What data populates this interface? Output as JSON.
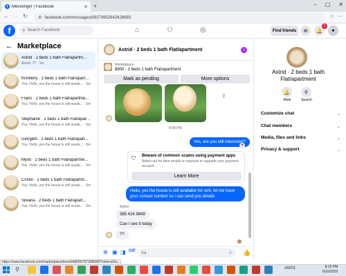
{
  "browser": {
    "tab_title": "Messenger | Facebook",
    "new_tab": "+",
    "url": "facebook.com/messages/t/8274952642628683",
    "window_controls": [
      "–",
      "▢",
      "✕"
    ]
  },
  "fb_header": {
    "search_placeholder": "Search Facebook",
    "find_friends": "Find friends",
    "notif_count": "2"
  },
  "left": {
    "title": "Marketplace",
    "items": [
      {
        "name": "Astrid · 2 beds 1 bath Flat/apartm...",
        "preview": "Astrid: ?? · 1m",
        "selected": true
      },
      {
        "name": "Kimberly · 2 beds 1 bath Flat/apart...",
        "preview": "You: Hello, yes the house is still availa... · 5m"
      },
      {
        "name": "Franc · 2 beds 1 bath Flat/apartme...",
        "preview": "You: Hello, yes the house is still availa... · 5m"
      },
      {
        "name": "Stephanie · 2 beds 1 bath Flat/apar...",
        "preview": "You: Hello, yes the house is still availa... · 5m"
      },
      {
        "name": "Giorgeth · 2 beds 1 bath Flat/apart...",
        "preview": "You: Hello, yes the house is still availa... · 5m"
      },
      {
        "name": "Mysti · 2 beds 1 bath Flat/apartme...",
        "preview": "You: Hello, yes the house is still availa... · 6m"
      },
      {
        "name": "Cristin · 2 beds 1 bath Flat/apartm...",
        "preview": "You: Hello, yes the house is still availa... · 6m"
      },
      {
        "name": "Silvana · 2 beds 1 bath Flat/apart...",
        "preview": "You: Hello, yes the house is still availa... · 6m"
      }
    ]
  },
  "chat": {
    "title": "Astrid · 2 beds 1 bath Flat/apartment",
    "marketplace_label": "Marketplace",
    "price_line": "$900 - 2 beds 1 bath Flat/apartment",
    "mark_pending": "Mark as pending",
    "more_options": "More options",
    "timestamp": "8:08 PM",
    "msg_interested": "Yes, are you still interested?",
    "scam_title": "Beware of common scams using payment apps",
    "scam_text": "Watch out for fake emails or requests to upgrade your payment account.",
    "learn_more": "Learn More",
    "msg_reply": "Hello, yes the house is still available for rent, let me have your contact number so i can send you details",
    "sender_name": "Astrid",
    "msg_phone": "385 416 9849",
    "msg_see": "Can I see it today",
    "msg_q": "??",
    "composer_placeholder": "Aa"
  },
  "right": {
    "name": "Astrid · 2 beds 1 bath Flat/apartment",
    "mute": "Mute",
    "search": "Search",
    "rows": [
      "Customize chat",
      "Chat members",
      "Media, files and links",
      "Privacy & support"
    ]
  },
  "status_url": "https://www.facebook.com/marketplace/item/948095797368680/?referralSu...",
  "taskbar": {
    "weather": "AW01",
    "time": "8:15 PM",
    "date": "6/16/2025"
  },
  "colors": {
    "fb_blue": "#0866ff",
    "selected_bg": "#e7f3ff",
    "bubble_gray": "#f0f2f5"
  }
}
